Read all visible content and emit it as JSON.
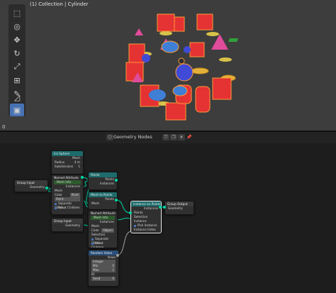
{
  "viewport": {
    "title": "(1) Collection | Cylinder",
    "frame_number": "0",
    "tools": [
      "select-box-icon",
      "cursor-icon",
      "move-icon",
      "rotate-icon",
      "scale-icon",
      "transform-icon",
      "annotate-icon",
      "measure-icon",
      "add-cube-icon"
    ]
  },
  "node_editor": {
    "title": "Geometry Nodes"
  },
  "nodes": {
    "ico": {
      "title": "Ico Sphere",
      "output": "Mesh",
      "radius_label": "Radius",
      "radius_value": "4 m",
      "subdiv_label": "Subdivisions",
      "subdiv_value": "1"
    },
    "named_attr1": {
      "title": "Named Attribute",
      "badge": "Mesh Info",
      "input": "Mesh",
      "output": "Instances",
      "domain_label": "Point",
      "domain_value": "Point",
      "domain2_value": "Point",
      "separate": "Separate Childr...",
      "reset": "Reset Children"
    },
    "points": {
      "title": "Points",
      "out": "Points",
      "in": "Instances"
    },
    "mesh_to_points": {
      "title": "Mesh to Points",
      "out": "Points",
      "in": "Mesh"
    },
    "named_attr2": {
      "title": "Named Attribute",
      "badge": "Mesh Info",
      "output": "Instances",
      "input": "Mesh",
      "domain_value": "Object",
      "selection": "Selection",
      "separate": "Separate Childr...",
      "reset": "Reset Children"
    },
    "group_input1": {
      "title": "Group Input",
      "output": "Geometry"
    },
    "group_input2": {
      "title": "Group Input",
      "output": "Geometry"
    },
    "instance_on_points": {
      "title": "Instance on Points",
      "output": "Instances",
      "points": "Points",
      "selection": "Selection",
      "instance": "Instance",
      "pick": "Pick Instance",
      "index": "Instance Index"
    },
    "group_output": {
      "title": "Group Output",
      "input": "Geometry"
    },
    "random_value": {
      "title": "Random Value",
      "output": "Value",
      "type": "Integer",
      "min": "Min",
      "min_value": "0",
      "max": "Max",
      "max_value": "1",
      "id": "ID",
      "seed": "Seed",
      "seed_value": "0"
    }
  },
  "colors": {
    "geometry_header": "#1e6b6b",
    "input_header": "#7a3a3a",
    "utility_header": "#2b4f7a",
    "geometry_socket": "#00d6a3",
    "float_socket": "#a1a1a1",
    "int_socket": "#598c5c",
    "selection": "#ff8c00"
  }
}
